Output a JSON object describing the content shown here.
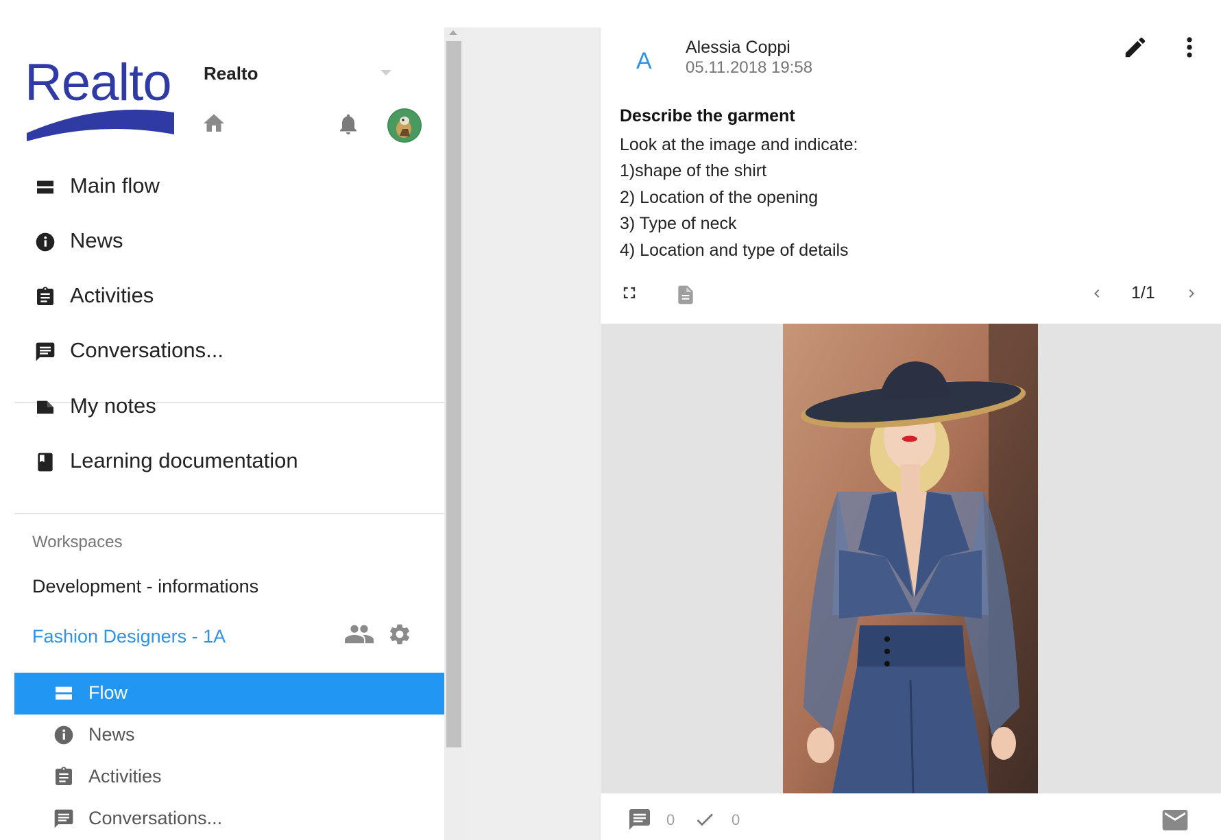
{
  "app": {
    "logo_text": "Realto",
    "org_name": "Realto"
  },
  "nav": {
    "items": [
      {
        "label": "Main flow",
        "icon": "view-stream-icon"
      },
      {
        "label": "News",
        "icon": "info-icon"
      },
      {
        "label": "Activities",
        "icon": "assignment-icon"
      },
      {
        "label": "Conversations...",
        "icon": "chat-icon"
      },
      {
        "label": "My notes",
        "icon": "label-icon"
      },
      {
        "label": "Learning documentation",
        "icon": "book-icon"
      }
    ]
  },
  "workspaces": {
    "header": "Workspaces",
    "items": [
      {
        "name": "Development - informations"
      },
      {
        "name": "Fashion Designers - 1A",
        "color": "#2c93e8"
      }
    ],
    "sub_items": [
      {
        "label": "Flow",
        "icon": "view-stream-icon",
        "active": true
      },
      {
        "label": "News",
        "icon": "info-icon"
      },
      {
        "label": "Activities",
        "icon": "assignment-icon"
      },
      {
        "label": "Conversations...",
        "icon": "chat-icon"
      }
    ]
  },
  "post": {
    "author_initial": "A",
    "author_name": "Alessia Coppi",
    "date": "05.11.2018 19:58",
    "title": "Describe the garment",
    "body_lines": [
      "Look at the image and indicate:",
      "1)shape of the shirt",
      "2) Location of the opening",
      "3) Type of neck",
      "4) Location and type of details"
    ],
    "page_indicator": "1/1",
    "comment_count": "0",
    "done_count": "0"
  },
  "colors": {
    "accent": "#2196f3",
    "link": "#2c93e8",
    "logo": "#2f3aa5"
  }
}
